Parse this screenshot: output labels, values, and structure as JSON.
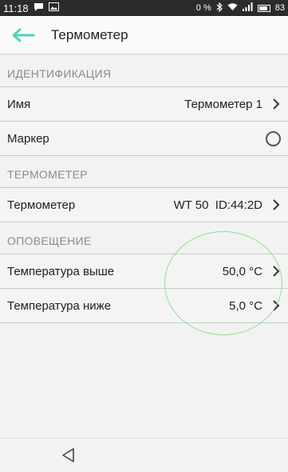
{
  "status_bar": {
    "time": "11:18",
    "icons": [
      "chat-bubble-icon",
      "image-icon",
      "bluetooth-icon",
      "wifi-icon",
      "signal-icon",
      "battery-icon"
    ],
    "data_speed": "0 %",
    "battery": "83"
  },
  "app_bar": {
    "title": "Термометер",
    "accent_color": "#4fd4b8"
  },
  "sections": {
    "identification": {
      "header": "ИДЕНТИФИКАЦИЯ",
      "name_label": "Имя",
      "name_value": "Термометер 1",
      "marker_label": "Маркер"
    },
    "thermometer": {
      "header": "ТЕРМОМЕТЕР",
      "label": "Термометер",
      "value": "WT 50  ID:44:2D"
    },
    "alerts": {
      "header": "ОПОВЕЩЕНИЕ",
      "above_label": "Температура выше",
      "above_value": "50,0 °C",
      "below_label": "Температура ниже",
      "below_value": "5,0 °C"
    }
  },
  "highlight_color": "#8fe08f"
}
